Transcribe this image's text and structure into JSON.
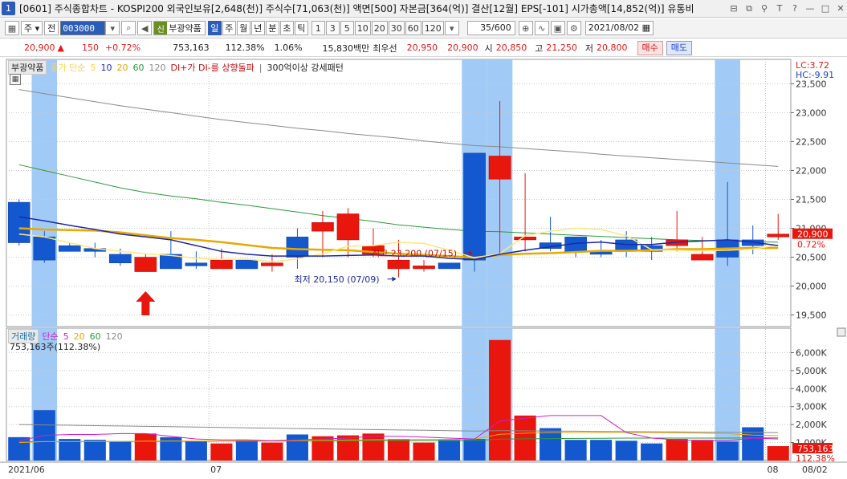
{
  "window": {
    "number": "1",
    "title": "[0601] 주식종합차트 - KOSPI200 외국인보유[2,648(천)] 주식수[71,063(천)] 액면[500] 자본금[364(억)] 결산[12월] EPS[-101] 시가총액[14,852(억)] 유통비"
  },
  "toolbar": {
    "market": "주",
    "jeon": "전",
    "code": "003000",
    "shin_badge": "신",
    "stock_name": "부광약품",
    "periods": [
      "일",
      "주",
      "월",
      "년",
      "분",
      "초",
      "틱"
    ],
    "active_period": "일",
    "intervals": [
      "1",
      "3",
      "5",
      "10",
      "20",
      "30",
      "60",
      "120"
    ],
    "count": "35/600",
    "date": "2021/08/02"
  },
  "quote": {
    "price": "20,900",
    "arrow": "▲",
    "change": "150",
    "change_pct": "+0.72%",
    "volume": "753,163",
    "volume_ratio": "112.38%",
    "turnover": "1.06%",
    "amount": "15,830백만",
    "best_label": "최우선",
    "ask": "20,950",
    "bid": "20,900",
    "open_label": "시",
    "open": "20,850",
    "high_label": "고",
    "high": "21,250",
    "low_label": "저",
    "low": "20,800",
    "buy_label": "매수",
    "sell_label": "매도"
  },
  "legend_price": {
    "name": "부광약품",
    "ma_label": "종가 단순",
    "ma_periods": [
      "5",
      "10",
      "20",
      "60",
      "120"
    ],
    "signal1": "DI+가 DI-를 상향돌파",
    "signal2": "300억이상 강세패턴",
    "lc": "LC:3.72",
    "hc": "HC:-9.91"
  },
  "legend_volume": {
    "name": "거래량",
    "ma_label": "단순",
    "ma_periods": [
      "5",
      "20",
      "60",
      "120"
    ],
    "current": "753,163주(112.38%)"
  },
  "annotations": {
    "high": "최고 23,200 (07/15)",
    "low": "최저 20,150 (07/09)"
  },
  "badges": {
    "price": "20,900",
    "pct": "0.72%",
    "volume": "753,163",
    "volume_pct": "112.38%"
  },
  "colors": {
    "up": "#e8160c",
    "down": "#1458d0",
    "highlight": "#9cc8f5",
    "ma5": "#ffe680",
    "ma10": "#1c2aa8",
    "ma20": "#e8a800",
    "ma60": "#2b9a3a",
    "ma120": "#8a8a8a",
    "vma5": "#d020c8",
    "vma20": "#e8a800",
    "vma60": "#2b9a3a",
    "vma120": "#8a8a8a"
  },
  "chart_data": {
    "type": "candlestick",
    "x": [
      "06/21",
      "06/22",
      "06/23",
      "06/24",
      "06/25",
      "06/28",
      "06/29",
      "06/30",
      "07/01",
      "07/02",
      "07/05",
      "07/06",
      "07/07",
      "07/08",
      "07/09",
      "07/12",
      "07/13",
      "07/14",
      "07/15",
      "07/16",
      "07/19",
      "07/20",
      "07/21",
      "07/22",
      "07/23",
      "07/26",
      "07/27",
      "07/28",
      "07/29",
      "07/30",
      "08/02"
    ],
    "open": [
      21450,
      20850,
      20700,
      20650,
      20550,
      20250,
      20550,
      20400,
      20300,
      20450,
      20350,
      20850,
      20950,
      20800,
      20550,
      20300,
      20300,
      20400,
      22300,
      21850,
      20800,
      20750,
      20850,
      20600,
      20800,
      20700,
      20700,
      20450,
      20800,
      20800,
      20850
    ],
    "high": [
      21500,
      20950,
      20750,
      20750,
      20650,
      20550,
      20950,
      20600,
      20650,
      20450,
      20550,
      21000,
      21300,
      21350,
      21000,
      20800,
      20450,
      20400,
      20600,
      23200,
      21950,
      21200,
      20700,
      20800,
      20950,
      20850,
      21300,
      20850,
      21800,
      21050,
      21250
    ],
    "low": [
      20700,
      20400,
      20600,
      20500,
      20350,
      20300,
      20300,
      20300,
      20300,
      20300,
      20250,
      20300,
      20500,
      20500,
      20500,
      20150,
      20250,
      20300,
      20250,
      20550,
      20600,
      20600,
      20500,
      20500,
      20500,
      20450,
      20600,
      20450,
      20350,
      20550,
      20800
    ],
    "close": [
      20750,
      20450,
      20600,
      20600,
      20400,
      20500,
      20300,
      20350,
      20450,
      20300,
      20400,
      20500,
      21100,
      21250,
      20700,
      20450,
      20350,
      20300,
      20450,
      22250,
      20850,
      20650,
      20600,
      20550,
      20600,
      20600,
      20800,
      20550,
      20500,
      20700,
      20900
    ],
    "volume": [
      1300000,
      2800000,
      1200000,
      1150000,
      1050000,
      1500000,
      1300000,
      1050000,
      950000,
      1150000,
      1000000,
      1450000,
      1350000,
      1400000,
      1500000,
      1200000,
      1000000,
      1150000,
      1200000,
      6700000,
      2500000,
      1800000,
      1150000,
      1150000,
      1100000,
      950000,
      1200000,
      1150000,
      1050000,
      1850000,
      800000
    ],
    "highlight_dates": [
      "06/22",
      "07/15",
      "07/16",
      "07/29"
    ],
    "signal_arrow_date": "06/28",
    "ma": {
      "5": [
        20900,
        20850,
        20750,
        20650,
        20600,
        20560,
        20530,
        20480,
        20460,
        20470,
        20420,
        20470,
        20560,
        20690,
        20700,
        20760,
        20740,
        20620,
        20490,
        20560,
        20870,
        20950,
        21000,
        20980,
        20870,
        20630,
        20620,
        20610,
        20620,
        20640,
        20710
      ],
      "10": [
        21200,
        21130,
        21050,
        20980,
        20900,
        20850,
        20800,
        20700,
        20600,
        20550,
        20520,
        20520,
        20520,
        20530,
        20540,
        20520,
        20520,
        20480,
        20460,
        20550,
        20620,
        20680,
        20740,
        20760,
        20720,
        20720,
        20760,
        20780,
        20800,
        20760,
        20700
      ],
      "20": [
        21000,
        20980,
        20970,
        20960,
        20930,
        20880,
        20830,
        20800,
        20760,
        20710,
        20660,
        20640,
        20630,
        20620,
        20590,
        20560,
        20540,
        20520,
        20490,
        20540,
        20560,
        20570,
        20590,
        20610,
        20610,
        20620,
        20640,
        20640,
        20650,
        20660,
        20660
      ],
      "60": [
        22100,
        22000,
        21900,
        21800,
        21700,
        21620,
        21560,
        21510,
        21450,
        21400,
        21340,
        21280,
        21220,
        21170,
        21120,
        21060,
        21020,
        20980,
        20950,
        20940,
        20920,
        20900,
        20880,
        20860,
        20840,
        20820,
        20800,
        20790,
        20780,
        20770,
        20760
      ],
      "120": [
        23400,
        23330,
        23260,
        23190,
        23120,
        23060,
        23000,
        22940,
        22880,
        22830,
        22780,
        22730,
        22690,
        22640,
        22600,
        22560,
        22510,
        22470,
        22430,
        22410,
        22380,
        22350,
        22320,
        22280,
        22250,
        22220,
        22190,
        22160,
        22130,
        22100,
        22070
      ]
    },
    "vma": {
      "5": [
        1100000,
        1400000,
        1450000,
        1450000,
        1500000,
        1500000,
        1350000,
        1200000,
        1150000,
        1150000,
        1100000,
        1150000,
        1200000,
        1250000,
        1350000,
        1350000,
        1300000,
        1250000,
        1200000,
        2200000,
        2350000,
        2500000,
        2500000,
        2500000,
        1550000,
        1250000,
        1150000,
        1100000,
        1100000,
        1250000,
        1200000
      ],
      "20": [
        1000000,
        1050000,
        1050000,
        1060000,
        1060000,
        1080000,
        1090000,
        1090000,
        1090000,
        1100000,
        1100000,
        1110000,
        1120000,
        1140000,
        1160000,
        1170000,
        1170000,
        1180000,
        1190000,
        1460000,
        1520000,
        1550000,
        1560000,
        1560000,
        1560000,
        1550000,
        1540000,
        1520000,
        1500000,
        1420000,
        1380000
      ],
      "60": [
        1050000,
        1050000,
        1060000,
        1060000,
        1060000,
        1060000,
        1070000,
        1070000,
        1080000,
        1080000,
        1080000,
        1090000,
        1090000,
        1090000,
        1100000,
        1100000,
        1110000,
        1110000,
        1110000,
        1190000,
        1210000,
        1220000,
        1230000,
        1240000,
        1250000,
        1250000,
        1250000,
        1250000,
        1250000,
        1260000,
        1260000
      ],
      "120": [
        2000000,
        1980000,
        1960000,
        1940000,
        1920000,
        1900000,
        1880000,
        1860000,
        1840000,
        1820000,
        1800000,
        1780000,
        1760000,
        1740000,
        1720000,
        1700000,
        1680000,
        1660000,
        1640000,
        1660000,
        1650000,
        1640000,
        1630000,
        1620000,
        1610000,
        1600000,
        1590000,
        1580000,
        1570000,
        1560000,
        1550000
      ]
    },
    "price_axis": {
      "min": 19300,
      "max": 23700,
      "ticks": [
        "19,500",
        "20,000",
        "20,500",
        "21,000",
        "21,500",
        "22,000",
        "22,500",
        "23,000",
        "23,500"
      ]
    },
    "volume_axis": {
      "max": 7000000,
      "ticks": [
        "1,000K",
        "2,000K",
        "3,000K",
        "4,000K",
        "5,000K",
        "6,000K"
      ]
    },
    "x_labels": [
      "2021/06",
      "07",
      "08",
      "08/02"
    ],
    "grid": true
  }
}
